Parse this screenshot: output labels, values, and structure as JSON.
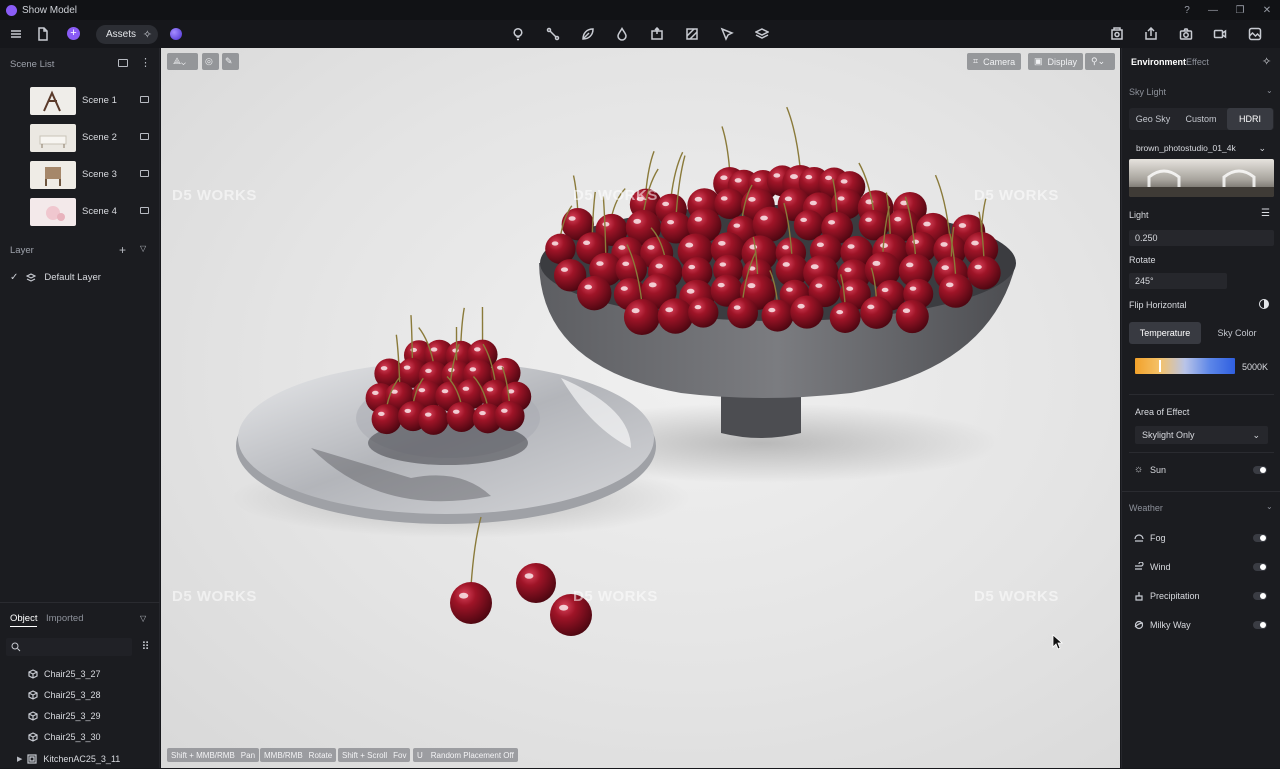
{
  "app": {
    "title": "Show Model"
  },
  "window_controls": [
    "?",
    "—",
    "❐",
    "✕"
  ],
  "toolbar": {
    "assets_label": "Assets"
  },
  "left_panel": {
    "scene_list_title": "Scene List",
    "scenes": [
      {
        "label": "Scene 1"
      },
      {
        "label": "Scene 2"
      },
      {
        "label": "Scene 3"
      },
      {
        "label": "Scene 4"
      }
    ],
    "layer_title": "Layer",
    "layers": [
      {
        "label": "Default Layer"
      }
    ],
    "object_tabs": [
      "Object",
      "Imported"
    ],
    "objects": [
      {
        "label": "Chair25_3_27"
      },
      {
        "label": "Chair25_3_28"
      },
      {
        "label": "Chair25_3_29"
      },
      {
        "label": "Chair25_3_30"
      },
      {
        "label": "KitchenAC25_3_11"
      }
    ]
  },
  "viewport": {
    "camera_label": "Camera",
    "display_label": "Display",
    "watermark": "D5 WORKS",
    "hints": [
      {
        "key": "Shift + MMB/RMB",
        "action": "Pan"
      },
      {
        "key": "MMB/RMB",
        "action": "Rotate"
      },
      {
        "key": "Shift + Scroll",
        "action": "Fov"
      },
      {
        "key": "U",
        "action": "Random Placement Off"
      }
    ]
  },
  "right_panel": {
    "tabs": [
      "Environment",
      "Effect"
    ],
    "sky_light_title": "Sky Light",
    "sky_modes": [
      "Geo Sky",
      "Custom",
      "HDRI"
    ],
    "hdri_name": "brown_photostudio_01_4k",
    "light_label": "Light",
    "light_value": "0.250",
    "rotate_label": "Rotate",
    "rotate_value": "245°",
    "flip_label": "Flip Horizontal",
    "temp_tabs": [
      "Temperature",
      "Sky Color"
    ],
    "temperature_value": "5000K",
    "temperature_level": 0.24,
    "area_label": "Area of Effect",
    "area_value": "Skylight Only",
    "sun_label": "Sun",
    "weather_title": "Weather",
    "weather_items": [
      {
        "label": "Fog"
      },
      {
        "label": "Wind"
      },
      {
        "label": "Precipitation"
      },
      {
        "label": "Milky Way"
      }
    ]
  },
  "colors": {
    "accent": "#8a5cf6",
    "panel": "#1b1c20",
    "cherry": "#8e0f1e"
  }
}
